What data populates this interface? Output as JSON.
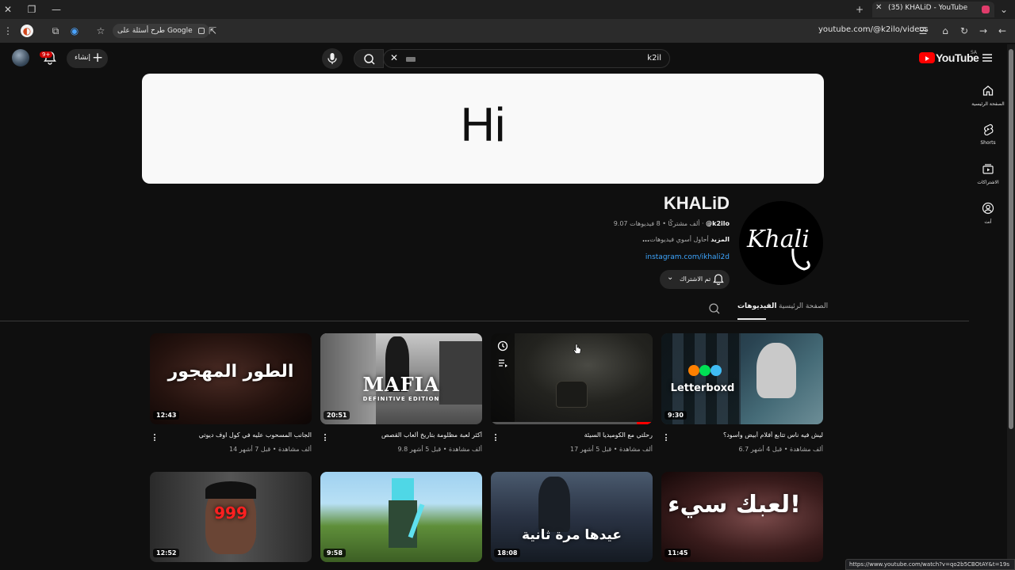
{
  "browser": {
    "tab_title": "(35) KHALiD - YouTube",
    "url": "youtube.com/@k2ilo/videos",
    "google_chip": "طرح أسئلة على Google",
    "status_url": "https://www.youtube.com/watch?v=qo2b5CBOtAY&t=19s"
  },
  "header": {
    "logo_text": "YouTube",
    "logo_region": "SA",
    "search_value": "k2il",
    "create_label": "إنشاء",
    "notif_count": "9+"
  },
  "banner": {
    "text": "Hi"
  },
  "channel": {
    "name": "KHALiD",
    "handle": "@k2ilo",
    "meta": "9.07 ألف مشتركًا • 8 فيديوهات",
    "description": "أحاول أسوي فيديوهات",
    "more": "...المزيد",
    "link": "instagram.com/ikhali2d",
    "subscribed_label": "تم الاشتراك",
    "avatar_text": "Khali"
  },
  "tabs": [
    {
      "label": "الصفحة الرئيسية"
    },
    {
      "label": "الفيديوهات"
    }
  ],
  "sidebar": [
    {
      "label": "الصفحة الرئيسية",
      "icon": "home-icon"
    },
    {
      "label": "Shorts",
      "icon": "shorts-icon"
    },
    {
      "label": "الاشتراكات",
      "icon": "subscriptions-icon"
    },
    {
      "label": "أنت",
      "icon": "you-icon"
    }
  ],
  "videos": [
    {
      "title": "ليش فيه ناس تتابع أفلام أبيض وأسود؟",
      "meta": "6.7 ألف مشاهدة • قبل 4 أشهر",
      "duration": "9:30",
      "thumb_text": "Letterboxd"
    },
    {
      "title": "رحلتي مع الكوميديا السيئة",
      "meta": "17 ألف مشاهدة • قبل 5 أشهر",
      "duration": "",
      "thumb_text": ""
    },
    {
      "title": "أكثر لعبة مظلومة بتاريخ ألعاب القصص",
      "meta": "9.8 ألف مشاهدة • قبل 5 أشهر",
      "duration": "20:51",
      "thumb_text": "MAFIA",
      "thumb_sub": "DEFINITIVE EDITION"
    },
    {
      "title": "الجانب المسحوب عليه في كول اوف ديوتي",
      "meta": "14 ألف مشاهدة • قبل 7 أشهر",
      "duration": "12:43",
      "thumb_text": "الطور المهجور"
    },
    {
      "title": "",
      "meta": "",
      "duration": "11:45",
      "thumb_text": "لعبك سيء!"
    },
    {
      "title": "",
      "meta": "",
      "duration": "18:08",
      "thumb_text": "عيدها مرة ثانية"
    },
    {
      "title": "",
      "meta": "",
      "duration": "9:58",
      "thumb_text": ""
    },
    {
      "title": "",
      "meta": "",
      "duration": "12:52",
      "thumb_text": "999"
    }
  ]
}
